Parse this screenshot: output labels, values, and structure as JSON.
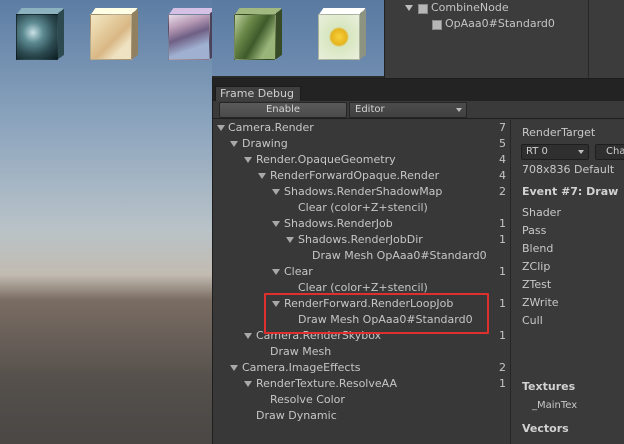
{
  "hierarchy": {
    "items": [
      {
        "label": "CombineNode"
      },
      {
        "label": "OpAaa0#Standard0"
      }
    ]
  },
  "frame_debug": {
    "tab_title": "Frame Debug",
    "enable_label": "Enable",
    "editor_value": "Editor",
    "tree": [
      {
        "label": "Camera.Render",
        "count": "7",
        "expanded": true
      },
      {
        "label": "Drawing",
        "count": "5",
        "expanded": true
      },
      {
        "label": "Render.OpaqueGeometry",
        "count": "4",
        "expanded": true
      },
      {
        "label": "RenderForwardOpaque.Render",
        "count": "4",
        "expanded": true
      },
      {
        "label": "Shadows.RenderShadowMap",
        "count": "2",
        "expanded": true
      },
      {
        "label": "Clear (color+Z+stencil)",
        "count": "",
        "expanded": false
      },
      {
        "label": "Shadows.RenderJob",
        "count": "1",
        "expanded": true
      },
      {
        "label": "Shadows.RenderJobDir",
        "count": "1",
        "expanded": true
      },
      {
        "label": "Draw Mesh OpAaa0#Standard0",
        "count": "",
        "expanded": false
      },
      {
        "label": "Clear",
        "count": "1",
        "expanded": true
      },
      {
        "label": "Clear (color+Z+stencil)",
        "count": "",
        "expanded": false
      },
      {
        "label": "RenderForward.RenderLoopJob",
        "count": "1",
        "expanded": true
      },
      {
        "label": "Draw Mesh OpAaa0#Standard0",
        "count": "",
        "expanded": false
      },
      {
        "label": "Camera.RenderSkybox",
        "count": "1",
        "expanded": true
      },
      {
        "label": "Draw Mesh",
        "count": "",
        "expanded": false
      },
      {
        "label": "Camera.ImageEffects",
        "count": "2",
        "expanded": true
      },
      {
        "label": "RenderTexture.ResolveAA",
        "count": "1",
        "expanded": true
      },
      {
        "label": "Resolve Color",
        "count": "",
        "expanded": false
      },
      {
        "label": "Draw Dynamic",
        "count": "",
        "expanded": false
      }
    ],
    "details": {
      "render_target_label": "RenderTarget",
      "rt_value": "RT 0",
      "channel_value": "Cha",
      "resolution": "708x836 Default",
      "event_title": "Event #7: Draw",
      "properties": [
        "Shader",
        "Pass",
        "Blend",
        "ZClip",
        "ZTest",
        "ZWrite",
        "Cull"
      ],
      "textures_heading": "Textures",
      "texture_name": "_MainTex",
      "vectors_heading": "Vectors"
    }
  },
  "colors": {
    "highlight_box": "#e0302e",
    "panel_bg": "#383838"
  }
}
